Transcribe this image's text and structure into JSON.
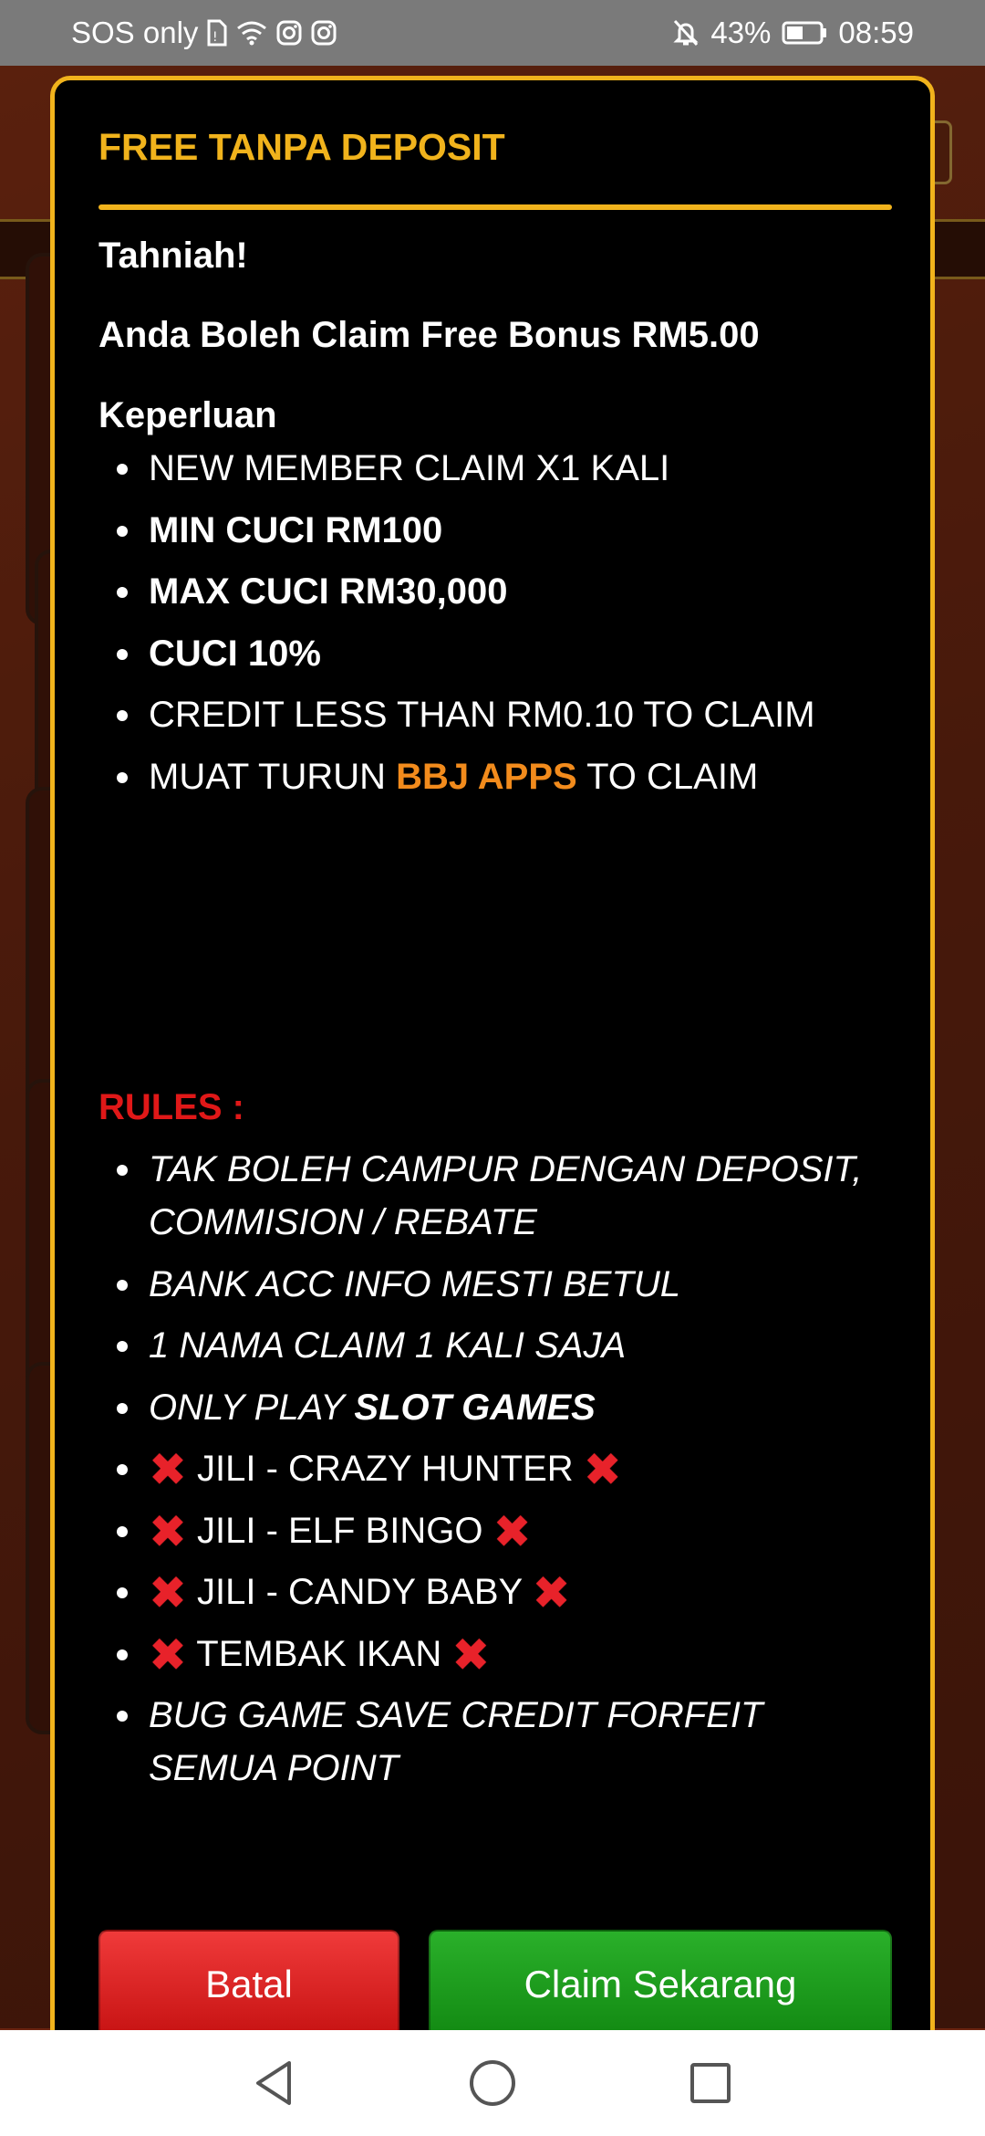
{
  "status_bar": {
    "carrier": "SOS only",
    "battery": "43%",
    "time": "08:59"
  },
  "modal": {
    "title": "FREE TANPA DEPOSIT",
    "congrats": "Tahniah!",
    "bonus_line": "Anda Boleh Claim Free Bonus RM5.00",
    "requirements_title": "Keperluan",
    "requirements": [
      "NEW MEMBER CLAIM X1 KALI",
      "MIN CUCI RM100",
      "MAX CUCI RM30,000",
      "CUCI 10%",
      "CREDIT LESS THAN RM0.10 TO CLAIM"
    ],
    "download_prefix": "MUAT TURUN",
    "download_app": "BBJ APPS",
    "download_suffix": "TO CLAIM",
    "rules_title": "RULES :",
    "rules": {
      "r1": "TAK BOLEH CAMPUR DENGAN DEPOSIT, COMMISION / REBATE",
      "r2": "BANK ACC INFO MESTI BETUL",
      "r3": "1 NAMA CLAIM 1 KALI SAJA",
      "r4_prefix": "ONLY PLAY",
      "r4_bold": "SLOT GAMES",
      "excluded": [
        "JILI - CRAZY HUNTER",
        "JILI - ELF BINGO",
        "JILI - CANDY BABY",
        "TEMBAK IKAN"
      ],
      "r_last": "BUG GAME SAVE CREDIT FORFEIT SEMUA POINT"
    },
    "cancel_label": "Batal",
    "claim_label": "Claim Sekarang"
  },
  "colors": {
    "accent": "#f1b31c",
    "rules_red": "#e01818",
    "app_name_orange": "#f28b1c",
    "cancel_red": "#d61f1f",
    "claim_green": "#1a9a1a"
  }
}
